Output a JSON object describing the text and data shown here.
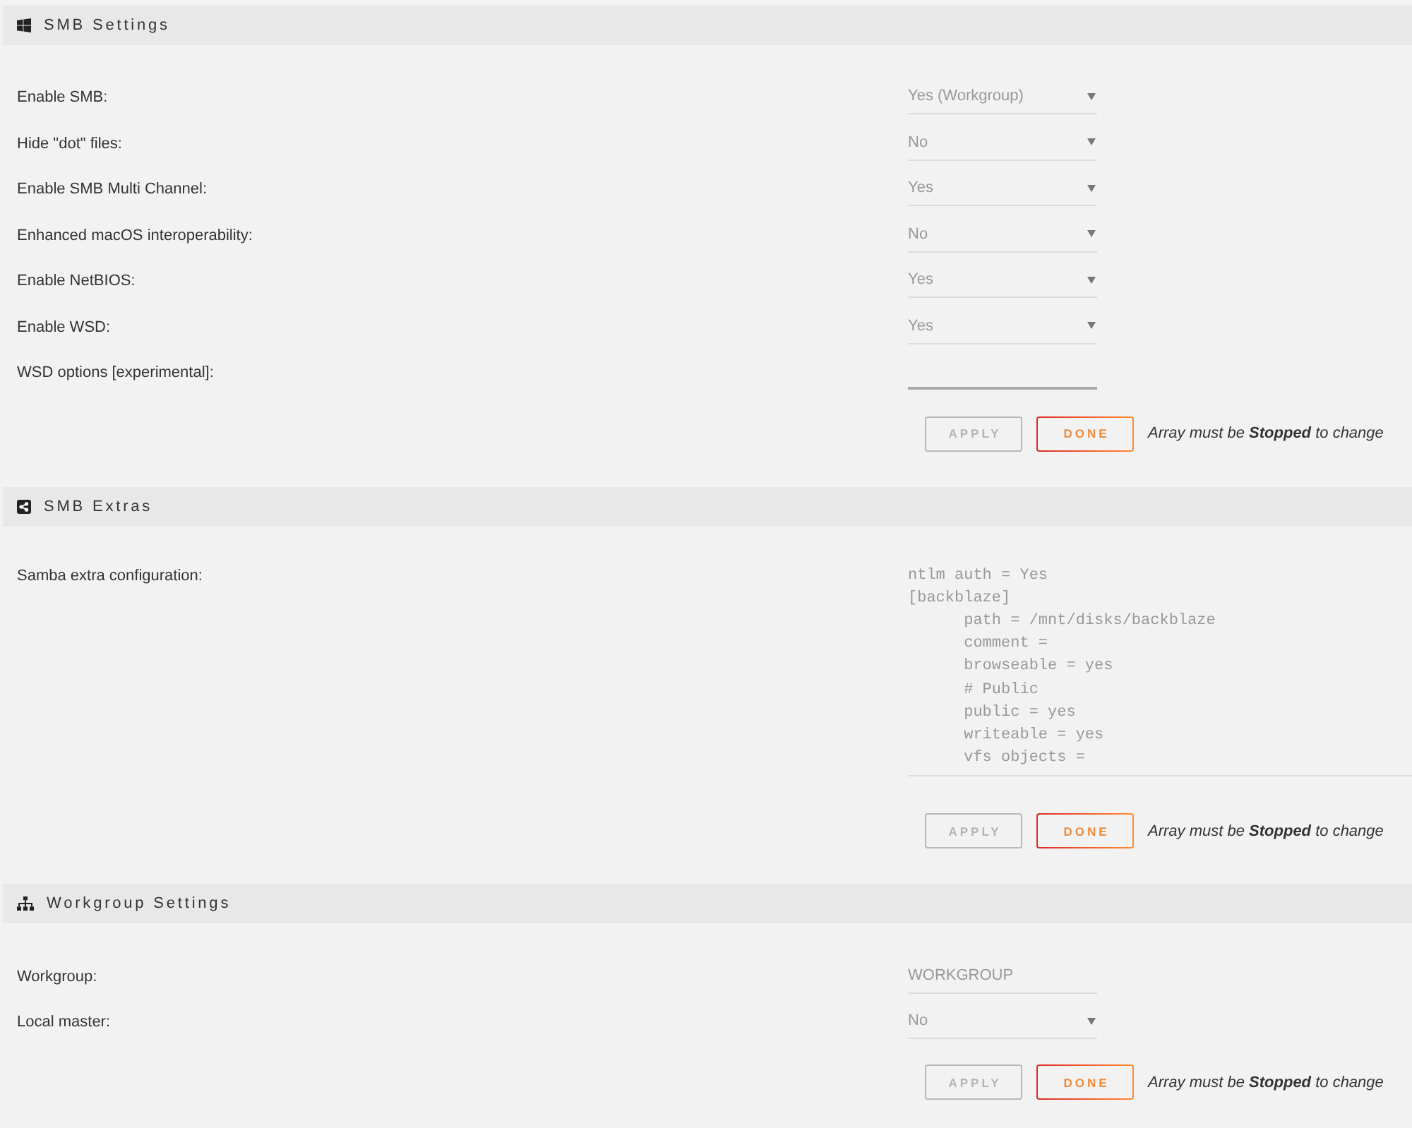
{
  "sections": [
    {
      "title": "SMB Settings",
      "rows": [
        {
          "label": "Enable SMB:",
          "kind": "select",
          "value": "Yes (Workgroup)"
        },
        {
          "label": "Hide \"dot\" files:",
          "kind": "select",
          "value": "No"
        },
        {
          "label": "Enable SMB Multi Channel:",
          "kind": "select",
          "value": "Yes"
        },
        {
          "label": "Enhanced macOS interoperability:",
          "kind": "select",
          "value": "No"
        },
        {
          "label": "Enable NetBIOS:",
          "kind": "select",
          "value": "Yes"
        },
        {
          "label": "Enable WSD:",
          "kind": "select",
          "value": "Yes"
        },
        {
          "label": "WSD options [experimental]:",
          "kind": "input"
        }
      ],
      "buttons": [
        {
          "label": "APPLY",
          "disabled": true
        },
        {
          "label": "DONE",
          "disabled": false
        }
      ],
      "note": "Array must be **Stopped** to change"
    },
    {
      "title": "SMB Extras",
      "rows": [
        {
          "label": "Samba extra configuration:",
          "kind": "textarea",
          "value": "ntlm auth = Yes\n[backblaze]\n\tpath = /mnt/disks/backblaze\n\tcomment =\n\tbrowseable = yes\n\t# Public\n\tpublic = yes\n\twriteable = yes\n\tvfs objects ="
        }
      ],
      "buttons": [
        {
          "label": "APPLY",
          "disabled": true
        },
        {
          "label": "DONE",
          "disabled": false
        }
      ],
      "note": "Array must be **Stopped** to change"
    },
    {
      "title": "Workgroup Settings",
      "rows": [
        {
          "label": "Workgroup:",
          "kind": "input",
          "value": "WORKGROUP"
        },
        {
          "label": "Local master:",
          "kind": "select",
          "value": "No"
        }
      ],
      "buttons": [
        {
          "label": "APPLY",
          "disabled": true
        },
        {
          "label": "DONE",
          "disabled": false
        }
      ],
      "note": "Array must be **Stopped** to change"
    }
  ]
}
